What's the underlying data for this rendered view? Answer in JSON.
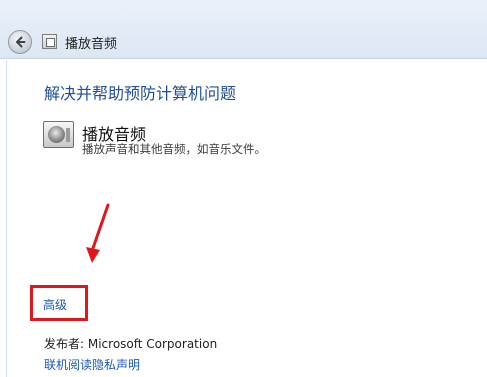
{
  "window": {
    "title": "播放音频"
  },
  "nav": {
    "back_icon": "back-arrow-icon"
  },
  "main": {
    "heading": "解决并帮助预防计算机问题",
    "item": {
      "icon": "speaker-icon",
      "title": "播放音频",
      "description": "播放声音和其他音频，如音乐文件。"
    },
    "advanced_link": "高级",
    "publisher": "发布者: Microsoft Corporation",
    "privacy_link": "联机阅读隐私声明"
  },
  "annotation": {
    "color": "#e0181b"
  }
}
